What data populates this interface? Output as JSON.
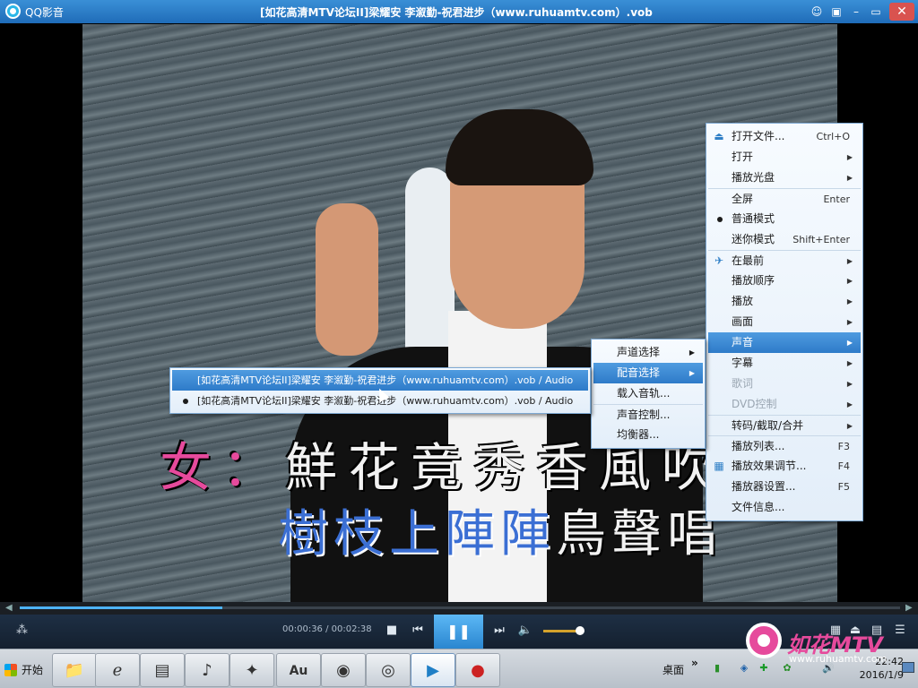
{
  "window": {
    "app_name": "QQ影音",
    "title": "[如花高清MTV论坛II]梁耀安 李溆勤-祝君进步（www.ruhuamtv.com）.vob",
    "btn_chat": "☺",
    "btn_skin": "▣",
    "btn_min": "–",
    "btn_max": "▭",
    "btn_close": "✕"
  },
  "video": {
    "lyric_line1_prefix": "女：",
    "lyric_line1": "鮮花竟秀香風吹,",
    "lyric_line2_sung": "樹枝上陣陣",
    "lyric_line2_rest": "鳥聲唱",
    "watermark_text": "如花MTV",
    "watermark_url": "www.ruhuamtv.com"
  },
  "controls": {
    "time": "00:00:36 / 00:02:38",
    "progress": 0.23,
    "volume": 0.85,
    "icon_footprint": "⁂",
    "icon_stop": "■",
    "icon_prev": "⏮",
    "icon_play": "❚❚",
    "icon_next": "⏭",
    "icon_volume": "🔈",
    "icon_screen": "▦",
    "icon_eject": "⏏",
    "icon_tools": "▤",
    "icon_list": "☰",
    "seek_left": "◀",
    "seek_right": "▶"
  },
  "main_menu": {
    "items": [
      {
        "label": "打开文件...",
        "shortcut": "Ctrl+O",
        "icon": "⏏"
      },
      {
        "label": "打开",
        "arrow": "▶"
      },
      {
        "label": "播放光盘",
        "arrow": "▶"
      },
      {
        "label": "全屏",
        "shortcut": "Enter"
      },
      {
        "label": "普通模式"
      },
      {
        "label": "迷你模式",
        "shortcut": "Shift+Enter"
      },
      {
        "label": "在最前",
        "arrow": "▶",
        "icon": "✈"
      },
      {
        "label": "播放顺序",
        "arrow": "▶"
      },
      {
        "label": "播放",
        "arrow": "▶"
      },
      {
        "label": "画面",
        "arrow": "▶"
      },
      {
        "label": "声音",
        "arrow": "▶"
      },
      {
        "label": "字幕",
        "arrow": "▶"
      },
      {
        "label": "歌词",
        "arrow": "▶"
      },
      {
        "label": "DVD控制",
        "arrow": "▶"
      },
      {
        "label": "转码/截取/合并",
        "arrow": "▶"
      },
      {
        "label": "播放列表...",
        "shortcut": "F3"
      },
      {
        "label": "播放效果调节...",
        "shortcut": "F4",
        "icon": "▦"
      },
      {
        "label": "播放器设置...",
        "shortcut": "F5"
      },
      {
        "label": "文件信息..."
      }
    ]
  },
  "sound_menu": {
    "items": [
      {
        "label": "声道选择",
        "arrow": "▶"
      },
      {
        "label": "配音选择",
        "arrow": "▶"
      },
      {
        "label": "载入音轨..."
      },
      {
        "label": "声音控制..."
      },
      {
        "label": "均衡器..."
      }
    ]
  },
  "track_menu": {
    "items": [
      {
        "label": "[如花高清MTV论坛II]梁耀安 李溆勤-祝君进步（www.ruhuamtv.com）.vob / Audio"
      },
      {
        "label": "[如花高清MTV论坛II]梁耀安 李溆勤-祝君进步（www.ruhuamtv.com）.vob / Audio"
      }
    ]
  },
  "taskbar": {
    "start_label": "开始",
    "apps": [
      {
        "icon": "📁"
      },
      {
        "icon": "ℯ"
      },
      {
        "icon": "▤"
      },
      {
        "icon": "♪"
      },
      {
        "icon": "✦"
      },
      {
        "icon": "Au"
      },
      {
        "icon": "◉"
      },
      {
        "icon": "◎"
      },
      {
        "icon": "▶"
      },
      {
        "icon": "●"
      }
    ],
    "desktop_label": "桌面",
    "desktop_chevron": "»",
    "tray": {
      "battery": "▮",
      "net": "◈",
      "plus": "✚",
      "shield": "✿",
      "volume": "🔊"
    },
    "time": "22:42",
    "date": "2016/1/9"
  }
}
